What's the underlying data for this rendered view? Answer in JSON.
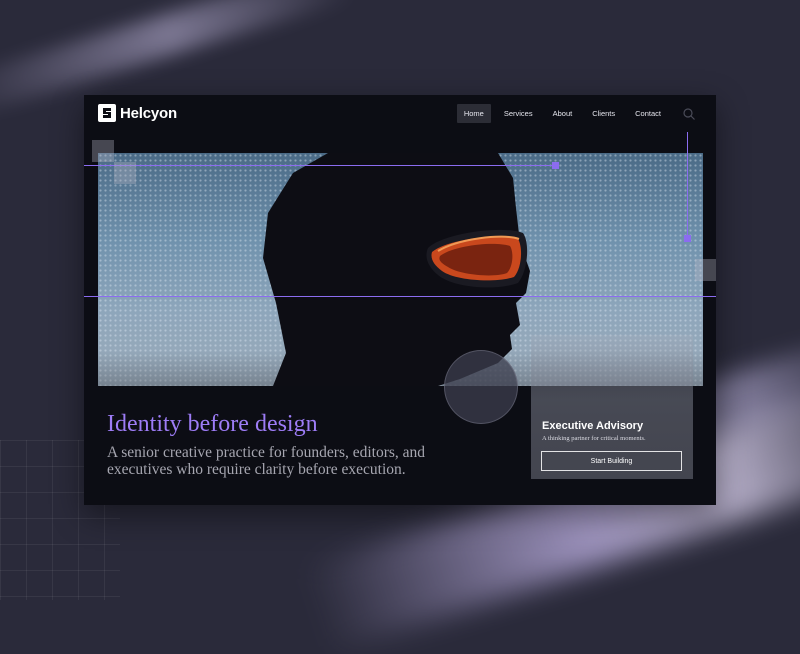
{
  "brand": {
    "name": "Helcyon",
    "logo_icon": "helcyon-logo-icon"
  },
  "nav": {
    "items": [
      {
        "label": "Home",
        "active": true
      },
      {
        "label": "Services",
        "active": false
      },
      {
        "label": "About",
        "active": false
      },
      {
        "label": "Clients",
        "active": false
      },
      {
        "label": "Contact",
        "active": false
      }
    ],
    "search_icon": "search-icon"
  },
  "hero": {
    "headline": "Identity before design",
    "subhead": "A senior creative practice for founders, editors, and executives who require clarity before execution."
  },
  "advisory": {
    "title": "Executive Advisory",
    "subtitle": "A thinking partner for critical moments.",
    "cta_label": "Start Building"
  },
  "colors": {
    "page_background": "#2a2a3a",
    "card_background": "#0c0d14",
    "accent_purple": "#8b6cf0",
    "headline_purple": "#9d7cf6",
    "text_muted": "#a6a6b0"
  }
}
